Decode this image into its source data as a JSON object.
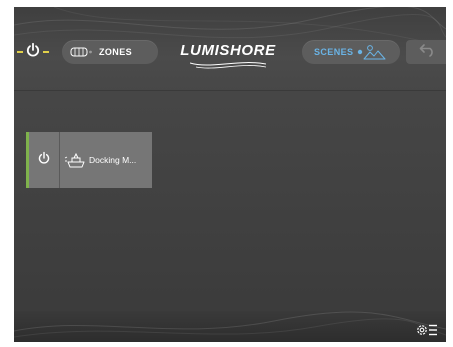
{
  "header": {
    "zones_label": "ZONES",
    "logo_text": "LUMISHORE",
    "scenes_label": "SCENES"
  },
  "tiles": [
    {
      "label": "Docking M...",
      "icon": "boat-icon",
      "active": true
    }
  ],
  "icons": {
    "master_power": "power-icon",
    "zones": "zone-light-icon",
    "scenes": "mountain-scene-icon",
    "back": "back-arrow-icon",
    "settings": "settings-menu-icon"
  },
  "colors": {
    "power_accent": "#e2d14a",
    "active_edge": "#7fb24c",
    "scenes_text": "#6ab4e6"
  }
}
